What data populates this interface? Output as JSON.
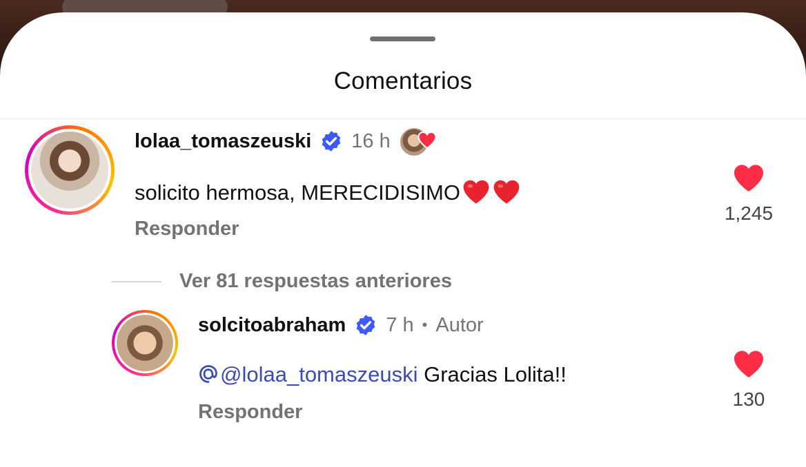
{
  "sheet": {
    "title": "Comentarios"
  },
  "comments": [
    {
      "username": "lolaa_tomaszeuski",
      "time": "16 h",
      "text": "solicito hermosa, MERECIDISIMO",
      "text_emoji": [
        "red-heart",
        "red-heart"
      ],
      "reply_label": "Responder",
      "like_count": "1,245",
      "liked_by_author": true
    },
    {
      "username": "solcitoabraham",
      "time": "7 h",
      "separator": "•",
      "author_badge": "Autor",
      "mention": "@lolaa_tomaszeuski",
      "text": " Gracias Lolita!!",
      "reply_label": "Responder",
      "like_count": "130"
    }
  ],
  "view_replies": {
    "label": "Ver 81 respuestas anteriores"
  },
  "colors": {
    "heart": "#ff2d45",
    "verified": "#3d5afe",
    "mention": "#3b4bb6",
    "muted": "#737373"
  },
  "icons": [
    "verified-badge-icon",
    "heart-icon",
    "mention-threads-icon",
    "red-heart-emoji-icon"
  ]
}
